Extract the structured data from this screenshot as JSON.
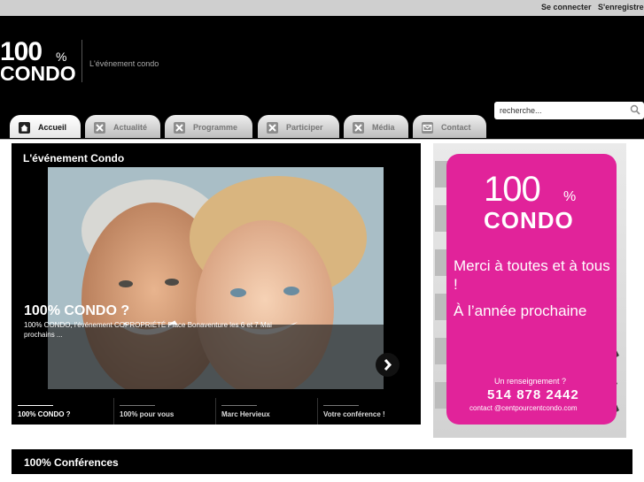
{
  "topbar": {
    "login": "Se connecter",
    "register": "S'enregistrer"
  },
  "header": {
    "logo_number": "100",
    "logo_percent": "%",
    "logo_word": "CONDO",
    "tagline": "L'événement condo"
  },
  "search": {
    "value": "recherche..."
  },
  "nav": {
    "tabs": [
      {
        "label": "Accueil",
        "icon": "home-icon"
      },
      {
        "label": "Actualité",
        "icon": "joomla-icon"
      },
      {
        "label": "Programme",
        "icon": "joomla-icon"
      },
      {
        "label": "Participer",
        "icon": "joomla-icon"
      },
      {
        "label": "Média",
        "icon": "joomla-icon"
      },
      {
        "label": "Contact",
        "icon": "mail-icon"
      }
    ]
  },
  "slider": {
    "title": "L'événement Condo",
    "caption_title": "100% CONDO ?",
    "caption_text": "100% CONDO, l'événement COPROPRIÉTÉ Place Bonaventure les 6 et 7 Mai prochains ...",
    "items": [
      "100% CONDO ?",
      "100% pour vous",
      "Marc Hervieux",
      "Votre conférence !"
    ]
  },
  "ad": {
    "logo_number": "100",
    "logo_percent": "%",
    "logo_word": "CONDO",
    "thanks": "Merci à toutes et à tous !",
    "next_year": "À l’année prochaine",
    "info_label": "Un renseignement ?",
    "phone": "514 878 2442",
    "email": "contact @centpourcentcondo.com"
  },
  "conferences": {
    "title": "100% Conférences"
  },
  "colors": {
    "accent_pink": "#e1239a",
    "background": "#000000",
    "tab_bg": "#d9d9d9"
  }
}
